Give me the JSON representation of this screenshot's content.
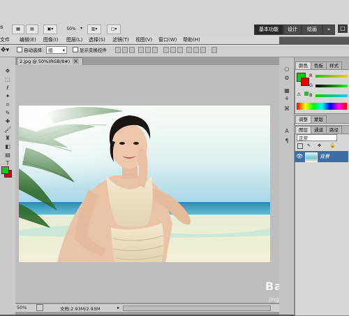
{
  "app": {
    "brand_fragment": "s",
    "zoom_value": "50%",
    "workspaces": [
      "基本功能",
      "设计",
      "绘画",
      "»"
    ],
    "window_control": "□"
  },
  "menu": [
    "文件",
    "编辑(E)",
    "图像(I)",
    "图层(L)",
    "选择(S)",
    "滤镜(T)",
    "视图(V)",
    "窗口(W)",
    "帮助(H)"
  ],
  "options": {
    "auto_select_label": "自动选择:",
    "auto_select_value": "组",
    "show_transform_label": "显示变换控件"
  },
  "document": {
    "tab_title": "2.jpg @ 50%(RGB/8#)",
    "tab_close": "×",
    "status_zoom": "50%",
    "status_doc": "文档:2.93M/2.93M"
  },
  "panels": {
    "color_tabs": [
      "颜色",
      "色板",
      "样式"
    ],
    "channels": [
      "R",
      "G",
      "B"
    ],
    "adjust_tabs": [
      "调整",
      "蒙版"
    ],
    "layer_tabs": [
      "图层",
      "通道",
      "路径"
    ],
    "blend_mode": "正常",
    "layer_name": "背景"
  },
  "colors": {
    "foreground": "#18c718",
    "background": "#e80000",
    "accent_layer": "#3a6ea5"
  },
  "watermark": {
    "text": "Bai 经验",
    "url": "jingyan.baidu.com"
  }
}
